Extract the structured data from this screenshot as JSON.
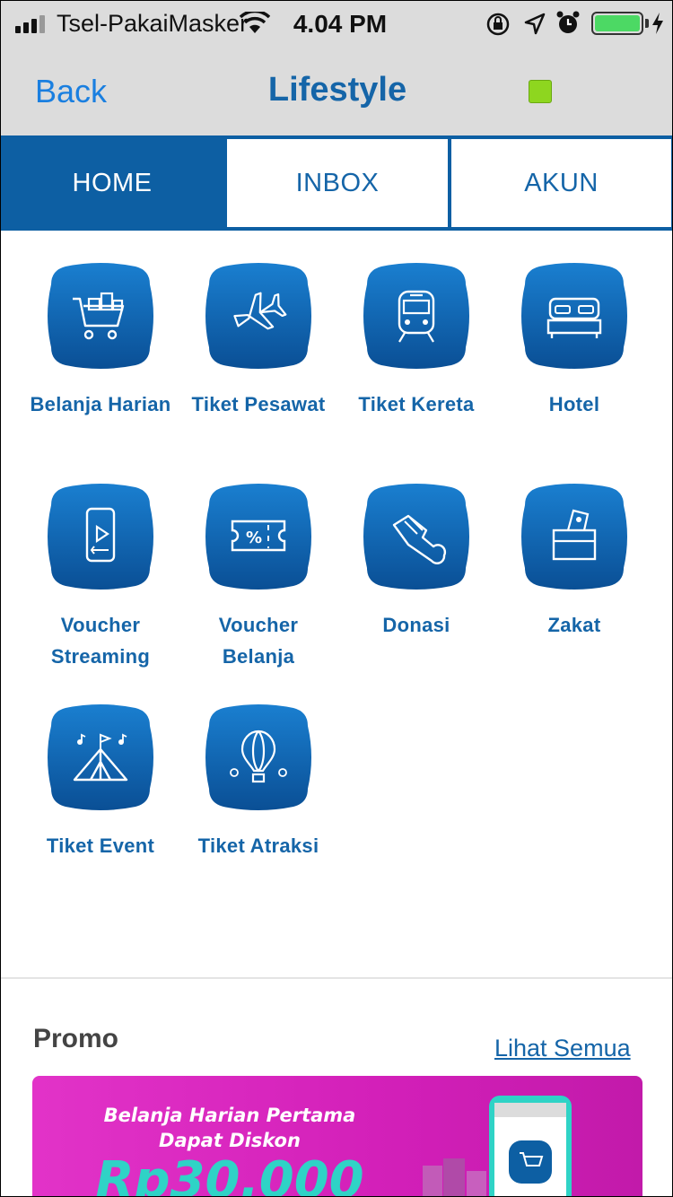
{
  "status_bar": {
    "carrier": "Tsel-PakaiMasker",
    "time": "4.04 PM"
  },
  "nav": {
    "back_label": "Back",
    "title": "Lifestyle"
  },
  "tabs": [
    {
      "label": "HOME",
      "active": true
    },
    {
      "label": "INBOX",
      "active": false
    },
    {
      "label": "AKUN",
      "active": false
    }
  ],
  "services": [
    {
      "label": "Belanja Harian",
      "icon": "cart-icon"
    },
    {
      "label": "Tiket Pesawat",
      "icon": "airplane-icon"
    },
    {
      "label": "Tiket Kereta",
      "icon": "train-icon"
    },
    {
      "label": "Hotel",
      "icon": "bed-icon"
    },
    {
      "label": "Voucher\nStreaming",
      "icon": "phone-play-icon"
    },
    {
      "label": "Voucher\nBelanja",
      "icon": "discount-ticket-icon"
    },
    {
      "label": "Donasi",
      "icon": "donation-hand-icon"
    },
    {
      "label": "Zakat",
      "icon": "zakat-box-icon"
    },
    {
      "label": "Tiket Event",
      "icon": "event-tent-icon"
    },
    {
      "label": "Tiket Atraksi",
      "icon": "hot-air-balloon-icon"
    }
  ],
  "promo": {
    "title": "Promo",
    "see_all": "Lihat Semua",
    "banner": {
      "line1": "Belanja Harian Pertama",
      "line2": "Dapat Diskon",
      "line3": "Rp30.000"
    }
  },
  "colors": {
    "primary": "#0d5fa3",
    "link": "#1a7fe0",
    "banner": "#d21fb8",
    "status_green": "#8ed61f"
  }
}
